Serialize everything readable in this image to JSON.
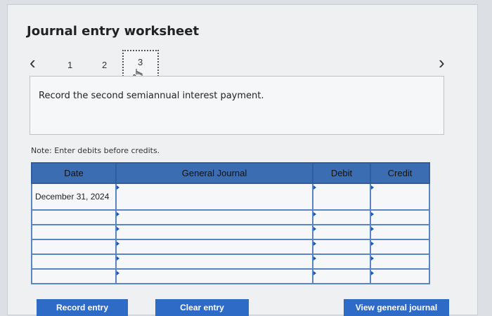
{
  "worksheet": {
    "title": "Journal entry worksheet",
    "prev_icon": "chevron-left-icon",
    "next_icon": "chevron-right-icon",
    "steps": [
      "1",
      "2",
      "3"
    ],
    "active_step": "3",
    "instruction": "Record the second semiannual interest payment.",
    "note": "Note: Enter debits before credits."
  },
  "table": {
    "headers": {
      "date": "Date",
      "journal": "General Journal",
      "debit": "Debit",
      "credit": "Credit"
    },
    "rows": [
      {
        "date": "December 31, 2024",
        "account": "",
        "debit": "",
        "credit": ""
      },
      {
        "date": "",
        "account": "",
        "debit": "",
        "credit": ""
      },
      {
        "date": "",
        "account": "",
        "debit": "",
        "credit": ""
      },
      {
        "date": "",
        "account": "",
        "debit": "",
        "credit": ""
      },
      {
        "date": "",
        "account": "",
        "debit": "",
        "credit": ""
      },
      {
        "date": "",
        "account": "",
        "debit": "",
        "credit": ""
      }
    ]
  },
  "buttons": {
    "record": "Record entry",
    "clear": "Clear entry",
    "view": "View general journal"
  },
  "colors": {
    "header_blue": "#3b6db3",
    "button_blue": "#2e6bc7"
  }
}
